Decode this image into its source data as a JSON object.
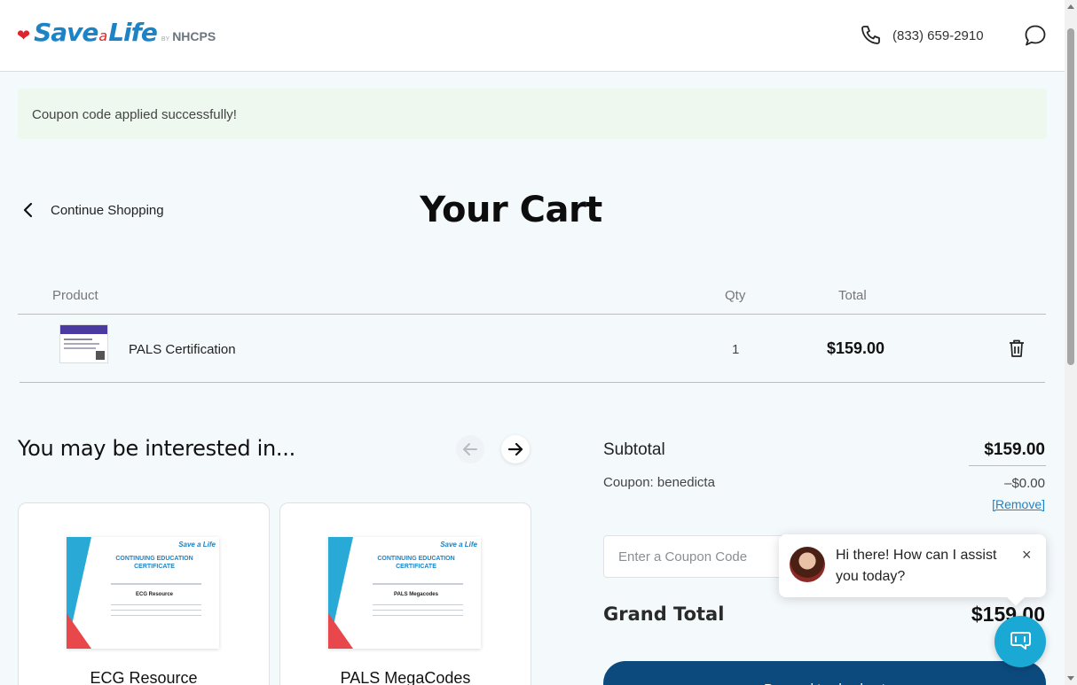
{
  "header": {
    "logo": {
      "save": "Save",
      "a": "a",
      "life": "Life",
      "by": "BY",
      "nhcps": "NHCPS"
    },
    "phone": "(833) 659-2910"
  },
  "notice": {
    "text": "Coupon code applied successfully!"
  },
  "nav": {
    "continue_label": "Continue Shopping"
  },
  "page_title": "Your Cart",
  "table": {
    "headers": {
      "product": "Product",
      "qty": "Qty",
      "total": "Total"
    },
    "rows": [
      {
        "name": "PALS Certification",
        "qty": "1",
        "total": "$159.00"
      }
    ]
  },
  "interested": {
    "title": "You may be interested in...",
    "cards": [
      {
        "name": "ECG Resource",
        "cert_brand": "Save a Life",
        "cert_title": "CONTINUING EDUCATION CERTIFICATE",
        "cert_course": "ECG Resource"
      },
      {
        "name": "PALS MegaCodes",
        "cert_brand": "Save a Life",
        "cert_title": "CONTINUING EDUCATION CERTIFICATE",
        "cert_course": "PALS Megacodes"
      }
    ]
  },
  "summary": {
    "subtotal_label": "Subtotal",
    "subtotal_value": "$159.00",
    "coupon_label": "Coupon: benedicta",
    "coupon_value": "–$0.00",
    "remove_label": "[Remove]",
    "coupon_placeholder": "Enter a Coupon Code",
    "grand_label": "Grand Total",
    "grand_value": "$159.00",
    "checkout_label": "Proceed to checkout"
  },
  "chat": {
    "message": "Hi there! How can I assist you today?",
    "close": "×"
  },
  "colors": {
    "brand_blue": "#1c84c6",
    "brand_red": "#e0242b",
    "checkout_navy": "#0c4a7e",
    "chat_teal": "#1aa8d4",
    "notice_bg": "#eef8ef"
  },
  "icons": [
    "heart-icon",
    "phone-icon",
    "chat-bubble-icon",
    "chevron-left-icon",
    "trash-icon",
    "arrow-left-icon",
    "arrow-right-icon",
    "close-icon",
    "chat-support-icon"
  ]
}
